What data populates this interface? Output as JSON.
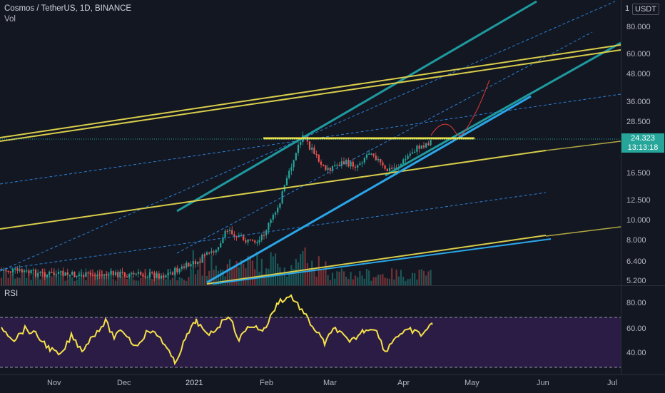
{
  "legend": {
    "symbol_title": "Cosmos / TetherUS, 1D, BINANCE",
    "volume_label": "Vol"
  },
  "rsi": {
    "label": "RSI",
    "levels": [
      80,
      60,
      40
    ],
    "upper_band": 70,
    "lower_band": 30,
    "line_color": "#f5e148",
    "band_color": "#2b1c46"
  },
  "price_axis": {
    "currency": "USDT",
    "top_fragment": "1",
    "ticks": [
      "80.000",
      "60.000",
      "48.000",
      "36.000",
      "28.500",
      "16.500",
      "12.500",
      "10.000",
      "8.000",
      "6.400",
      "5.200"
    ],
    "last_price": "24.323",
    "countdown": "13:13:18"
  },
  "time_axis": {
    "ticks": [
      "Nov",
      "Dec",
      "2021",
      "Feb",
      "Mar",
      "Apr",
      "May",
      "Jun",
      "Jul"
    ]
  },
  "colors": {
    "background": "#131722",
    "up": "#26a69a",
    "down": "#ef5350",
    "yellow_trendline": "#d8cd4a",
    "teal_channel": "#1e9a9f",
    "blue_trendline": "#2aa6e8",
    "resistance_line": "#f7e94a",
    "projection": "#e53935"
  }
}
